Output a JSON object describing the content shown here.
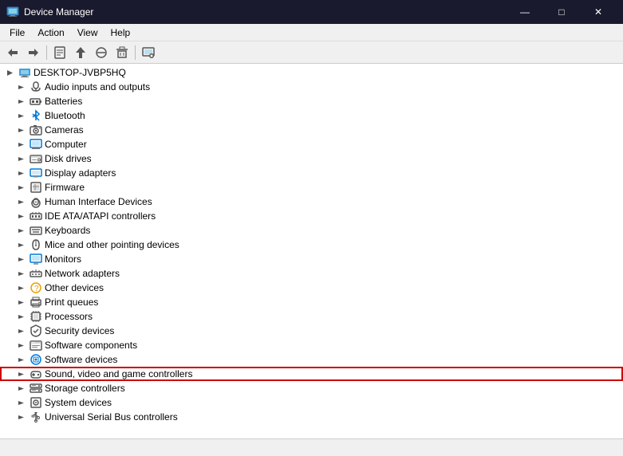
{
  "titleBar": {
    "title": "Device Manager",
    "icon": "🖥",
    "controls": {
      "minimize": "—",
      "maximize": "□",
      "close": "✕"
    }
  },
  "menuBar": {
    "items": [
      "File",
      "Action",
      "View",
      "Help"
    ]
  },
  "toolbar": {
    "buttons": [
      {
        "name": "back",
        "icon": "←"
      },
      {
        "name": "forward",
        "icon": "→"
      },
      {
        "name": "properties",
        "icon": "📋"
      },
      {
        "name": "update-driver",
        "icon": "⬆"
      },
      {
        "name": "uninstall",
        "icon": "✖"
      },
      {
        "name": "scan",
        "icon": "🔍"
      },
      {
        "name": "screen",
        "icon": "🖥"
      }
    ]
  },
  "treeRoot": {
    "label": "DESKTOP-JVBP5HQ",
    "items": [
      {
        "label": "Audio inputs and outputs",
        "icon": "🔊",
        "expanded": false
      },
      {
        "label": "Batteries",
        "icon": "🔋",
        "expanded": false
      },
      {
        "label": "Bluetooth",
        "icon": "🔵",
        "expanded": false
      },
      {
        "label": "Cameras",
        "icon": "📷",
        "expanded": false
      },
      {
        "label": "Computer",
        "icon": "💻",
        "expanded": false
      },
      {
        "label": "Disk drives",
        "icon": "💾",
        "expanded": false
      },
      {
        "label": "Display adapters",
        "icon": "🖥",
        "expanded": false
      },
      {
        "label": "Firmware",
        "icon": "📄",
        "expanded": false
      },
      {
        "label": "Human Interface Devices",
        "icon": "🖱",
        "expanded": false
      },
      {
        "label": "IDE ATA/ATAPI controllers",
        "icon": "⚙",
        "expanded": false
      },
      {
        "label": "Keyboards",
        "icon": "⌨",
        "expanded": false
      },
      {
        "label": "Mice and other pointing devices",
        "icon": "🖱",
        "expanded": false
      },
      {
        "label": "Monitors",
        "icon": "🖥",
        "expanded": false
      },
      {
        "label": "Network adapters",
        "icon": "🌐",
        "expanded": false
      },
      {
        "label": "Other devices",
        "icon": "❓",
        "expanded": false
      },
      {
        "label": "Print queues",
        "icon": "🖨",
        "expanded": false
      },
      {
        "label": "Processors",
        "icon": "⚙",
        "expanded": false
      },
      {
        "label": "Security devices",
        "icon": "🔒",
        "expanded": false
      },
      {
        "label": "Software components",
        "icon": "📦",
        "expanded": false
      },
      {
        "label": "Software devices",
        "icon": "💿",
        "expanded": false
      },
      {
        "label": "Sound, video and game controllers",
        "icon": "🎮",
        "expanded": false,
        "highlighted": true
      },
      {
        "label": "Storage controllers",
        "icon": "💾",
        "expanded": false
      },
      {
        "label": "System devices",
        "icon": "⚙",
        "expanded": false
      },
      {
        "label": "Universal Serial Bus controllers",
        "icon": "🔌",
        "expanded": false
      }
    ]
  },
  "icons": {
    "root": "🖥",
    "chevron-right": "▶",
    "chevron-down": "▼",
    "expand-down": "▾",
    "expand-right": "▸"
  }
}
